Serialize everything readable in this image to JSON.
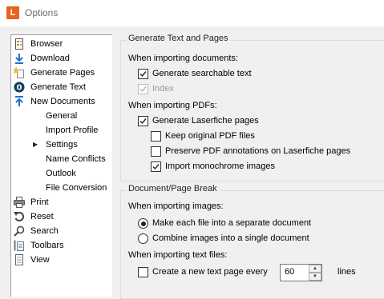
{
  "window": {
    "title": "Options",
    "logo_letter": "L",
    "accent": "#e8621a"
  },
  "tree": {
    "items": [
      {
        "label": "Browser",
        "icon": "browser-icon"
      },
      {
        "label": "Download",
        "icon": "download-arrow-icon"
      },
      {
        "label": "Generate Pages",
        "icon": "generate-pages-icon"
      },
      {
        "label": "Generate Text",
        "icon": "generate-text-icon"
      },
      {
        "label": "New Documents",
        "icon": "upload-arrow-icon"
      },
      {
        "label": "General"
      },
      {
        "label": "Import Profile"
      },
      {
        "label": "Settings",
        "selected": true
      },
      {
        "label": "Name Conflicts"
      },
      {
        "label": "Outlook"
      },
      {
        "label": "File Conversion"
      },
      {
        "label": "Print",
        "icon": "printer-icon"
      },
      {
        "label": "Reset",
        "icon": "reset-icon"
      },
      {
        "label": "Search",
        "icon": "search-icon"
      },
      {
        "label": "Toolbars",
        "icon": "toolbars-icon"
      },
      {
        "label": "View",
        "icon": "view-icon"
      }
    ]
  },
  "text_pages": {
    "title": "Generate Text and Pages",
    "importing_documents_label": "When importing documents:",
    "generate_searchable_text": {
      "label": "Generate searchable text",
      "checked": true
    },
    "index": {
      "label": "Index",
      "checked": true,
      "disabled": true
    },
    "importing_pdfs_label": "When importing PDFs:",
    "generate_laserfiche_pages": {
      "label": "Generate Laserfiche pages",
      "checked": true
    },
    "keep_original_pdf": {
      "label": "Keep original PDF files",
      "checked": false
    },
    "preserve_annotations": {
      "label": "Preserve PDF annotations on Laserfiche pages",
      "checked": false
    },
    "import_monochrome": {
      "label": "Import monochrome images",
      "checked": true
    }
  },
  "page_break": {
    "title": "Document/Page Break",
    "importing_images_label": "When importing images:",
    "separate_document": {
      "label": "Make each file into a separate document",
      "selected": true
    },
    "single_document": {
      "label": "Combine images into a single document",
      "selected": false
    },
    "importing_text_label": "When importing text files:",
    "create_text_page": {
      "label": "Create a new text page every",
      "checked": false
    },
    "lines_value": "60",
    "lines_label": "lines"
  }
}
